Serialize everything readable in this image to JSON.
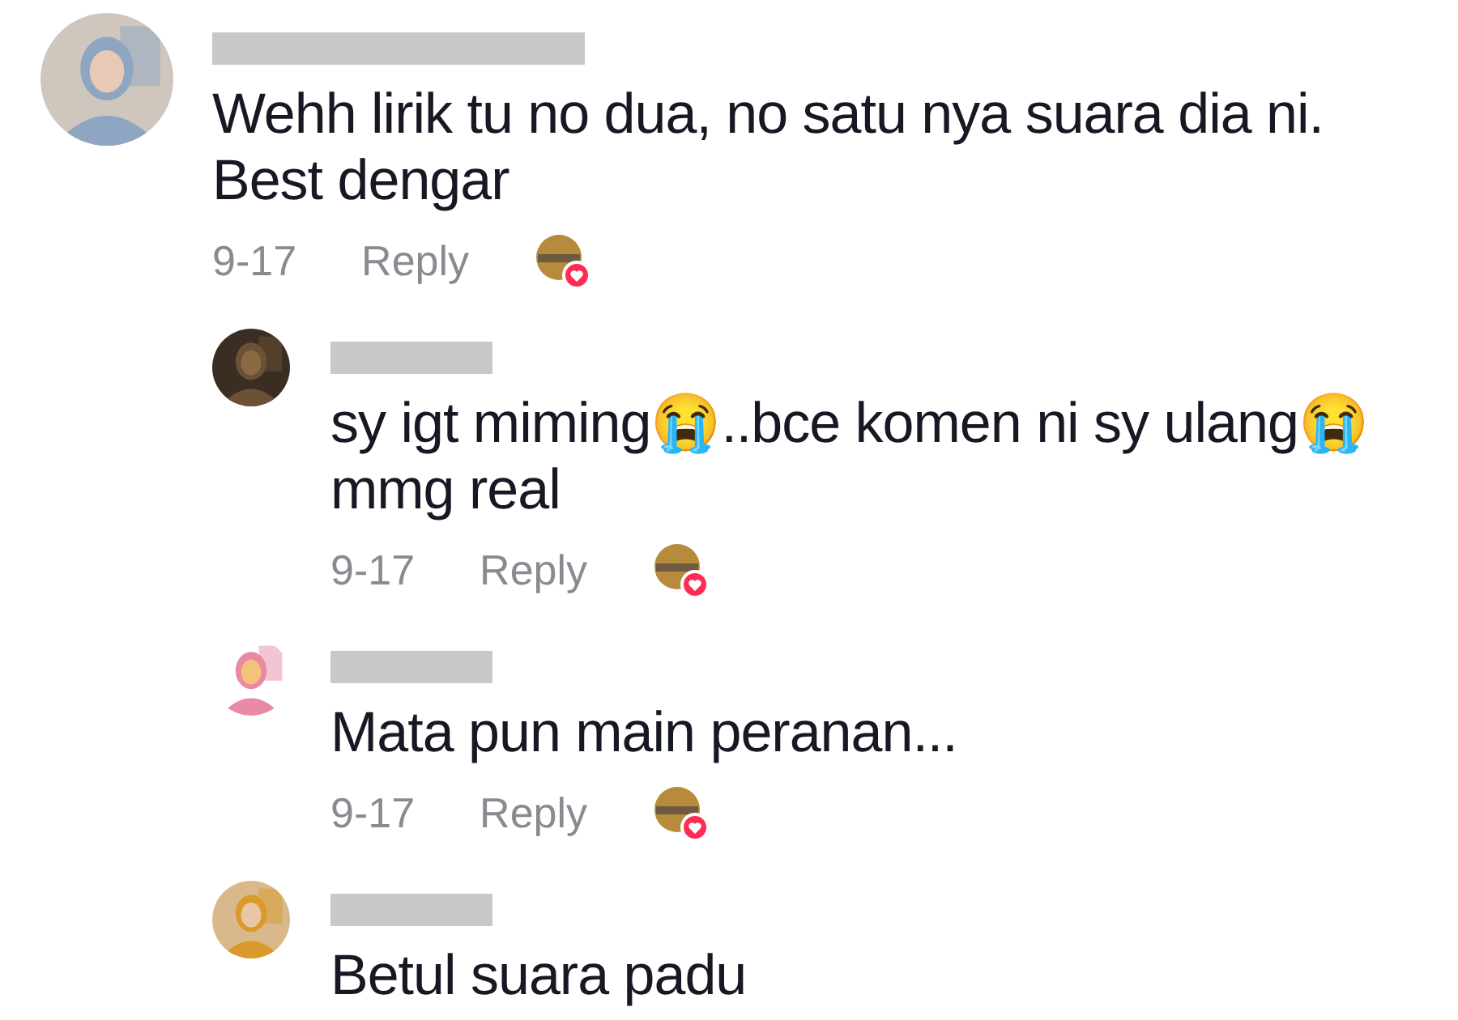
{
  "comments": [
    {
      "kind": "top",
      "name_redacted": true,
      "text": "Wehh lirik tu no dua, no satu nya suara dia ni. Best dengar",
      "date": "9-17",
      "reply_label": "Reply",
      "creator_liked": true
    },
    {
      "kind": "reply",
      "name_redacted": true,
      "text": "sy igt miming😭..bce komen ni sy ulang😭 mmg real",
      "date": "9-17",
      "reply_label": "Reply",
      "creator_liked": true
    },
    {
      "kind": "reply",
      "name_redacted": true,
      "text": "Mata pun main peranan...",
      "date": "9-17",
      "reply_label": "Reply",
      "creator_liked": true
    },
    {
      "kind": "reply",
      "name_redacted": true,
      "text": "Betul suara padu"
    }
  ]
}
